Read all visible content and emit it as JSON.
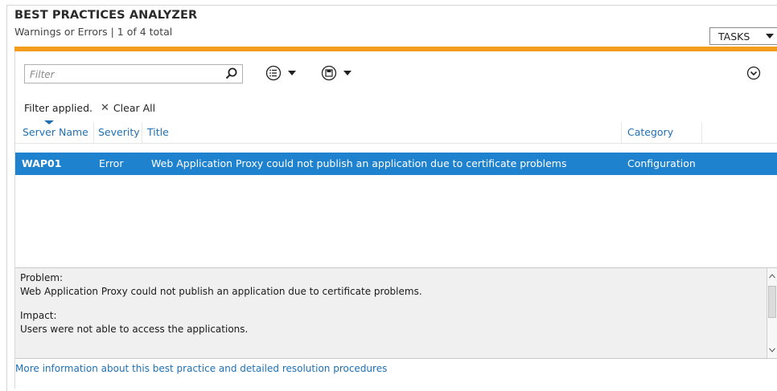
{
  "header": {
    "title": "BEST PRACTICES ANALYZER",
    "subtitle": "Warnings or Errors | 1 of 4 total",
    "tasks_label": "TASKS"
  },
  "toolbar": {
    "filter_placeholder": "Filter",
    "search_icon": "search-icon",
    "list_options_icon": "list-options-icon",
    "save_query_icon": "save-icon",
    "expand_icon": "chevron-circle-down-icon"
  },
  "filter_status": {
    "applied_label": "Filter applied.",
    "clear_all_label": "Clear All"
  },
  "table": {
    "columns": [
      "Server Name",
      "Severity",
      "Title",
      "Category"
    ],
    "rows": [
      {
        "server": "WAP01",
        "severity": "Error",
        "title": "Web Application Proxy could not publish an application due to certificate problems",
        "category": "Configuration",
        "selected": true
      }
    ]
  },
  "details": {
    "problem_label": "Problem:",
    "problem_text": "Web Application Proxy could not publish an application due to certificate problems.",
    "impact_label": "Impact:",
    "impact_text": "Users were not able to access the applications."
  },
  "more_info_link": "More information about this best practice and detailed resolution procedures",
  "colors": {
    "accent_orange": "#f39c1d",
    "selection_blue": "#1f82cf",
    "link_blue": "#1f6fb3"
  }
}
